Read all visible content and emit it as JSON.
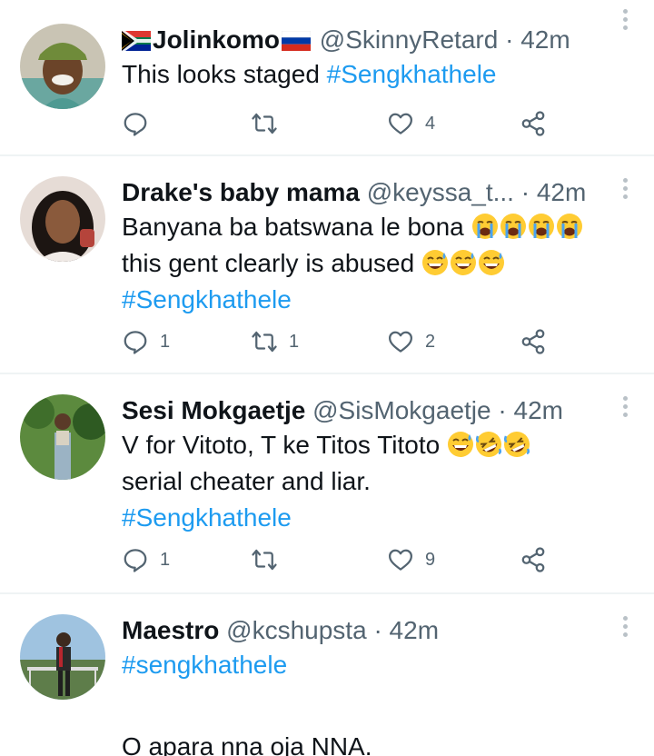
{
  "colors": {
    "link": "#1d9bf0",
    "muted": "#536471",
    "text": "#0f1419",
    "divider": "#eff3f4"
  },
  "tweets": [
    {
      "display_name": "Jolinkomo",
      "name_prefix_icon": "south-africa-flag-icon",
      "name_suffix_icon": "russia-flag-icon",
      "handle": "@SkinnyRetard",
      "dot": "·",
      "time": "42m",
      "text_line1": "This looks staged ",
      "hashtag": "#Sengkhathele",
      "replies": "",
      "retweets": "",
      "likes": "4"
    },
    {
      "display_name": "Drake's baby mama",
      "handle": "@keyssa_t...",
      "dot": "·",
      "time": "42m",
      "text_line1": "Banyana ba batswana le bona ",
      "text_line2": "this gent clearly is abused ",
      "line1_emoji": [
        "loudly-crying-face",
        "loudly-crying-face",
        "loudly-crying-face",
        "loudly-crying-face"
      ],
      "line2_emoji": [
        "grinning-sweat-face",
        "grinning-sweat-face",
        "grinning-sweat-face"
      ],
      "hashtag": "#Sengkhathele",
      "replies": "1",
      "retweets": "1",
      "likes": "2"
    },
    {
      "display_name": "Sesi Mokgaetje",
      "handle": "@SisMokgaetje",
      "dot": "·",
      "time": "42m",
      "text_line1": "V for Vitoto, T ke Titos Titoto ",
      "text_line2": "serial cheater and liar.",
      "line1_emoji": [
        "grinning-sweat-face",
        "rolling-laughing-face",
        "rolling-laughing-face"
      ],
      "hashtag": "#Sengkhathele",
      "replies": "1",
      "retweets": "",
      "likes": "9"
    },
    {
      "display_name": "Maestro",
      "handle": "@kcshupsta",
      "dot": "·",
      "time": "42m",
      "hashtag": "#sengkhathele",
      "text_line3": "O apara nna oja NNA."
    }
  ]
}
